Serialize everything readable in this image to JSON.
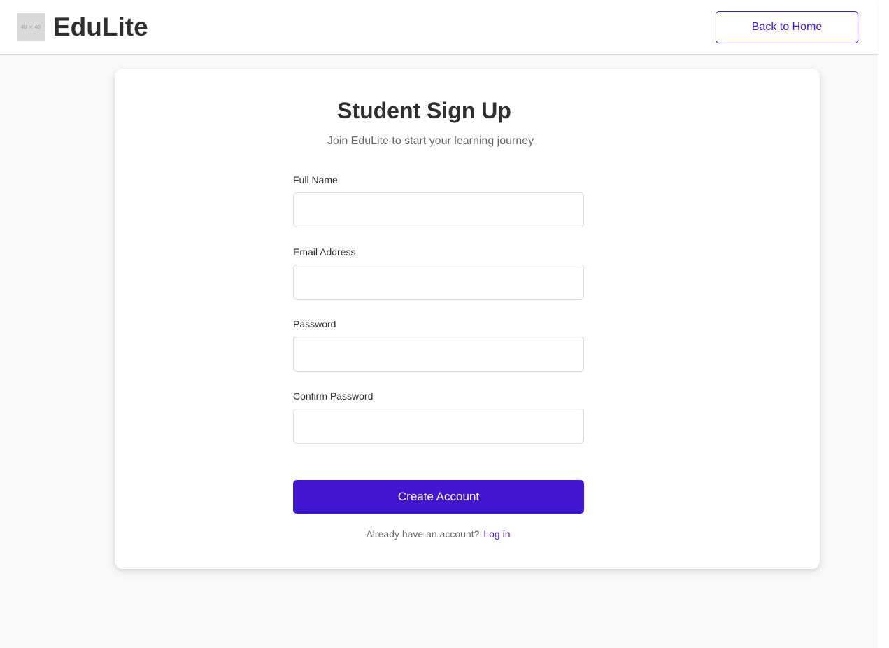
{
  "header": {
    "logo_placeholder": "40 × 40",
    "brand_name": "EduLite",
    "back_button_label": "Back to Home"
  },
  "form": {
    "title": "Student Sign Up",
    "subtitle": "Join EduLite to start your learning journey",
    "fields": [
      {
        "label": "Full Name",
        "value": "",
        "placeholder": ""
      },
      {
        "label": "Email Address",
        "value": "",
        "placeholder": ""
      },
      {
        "label": "Password",
        "value": "",
        "placeholder": ""
      },
      {
        "label": "Confirm Password",
        "value": "",
        "placeholder": ""
      }
    ],
    "submit_label": "Create Account",
    "login_prompt": "Already have an account?",
    "login_link_label": "Log in"
  },
  "colors": {
    "accent": "#4316d1",
    "page_background": "#f9f9f9",
    "card_background": "#ffffff",
    "text_primary": "#2f2f2f",
    "text_secondary": "#666666"
  }
}
